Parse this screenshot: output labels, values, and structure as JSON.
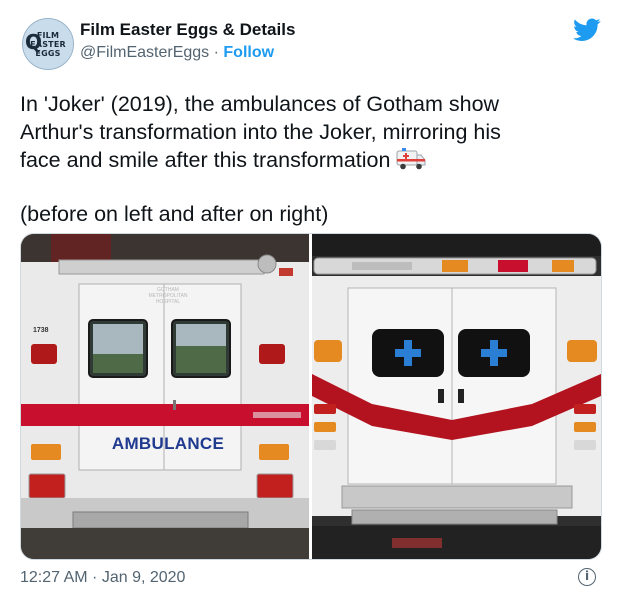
{
  "author": {
    "display_name": "Film Easter Eggs & Details",
    "handle": "@FilmEasterEggs",
    "separator": "·",
    "follow_label": "Follow",
    "avatar_lines": [
      "FILM",
      "EASTER",
      "EGGS"
    ]
  },
  "tweet": {
    "line1": "In 'Joker' (2019), the ambulances of Gotham show",
    "line2": "Arthur's transformation into the Joker, mirroring his",
    "line3": "face and smile after this transformation",
    "emoji": "ambulance-emoji",
    "line4": "(before on left and after on right)"
  },
  "media": {
    "left_photo": {
      "door_label": "AMBULANCE",
      "unit_number": "1738",
      "hospital_text": [
        "GOTHAM",
        "METROPOLITAN",
        "HOSPITAL"
      ]
    },
    "right_photo": {}
  },
  "footer": {
    "timestamp": "12:27 AM · Jan 9, 2020",
    "info_icon": "info-icon"
  },
  "colors": {
    "link": "#1d9bf0",
    "secondary_text": "#536471",
    "stripe_red": "#c8102e",
    "label_blue": "#1f3a8f"
  }
}
